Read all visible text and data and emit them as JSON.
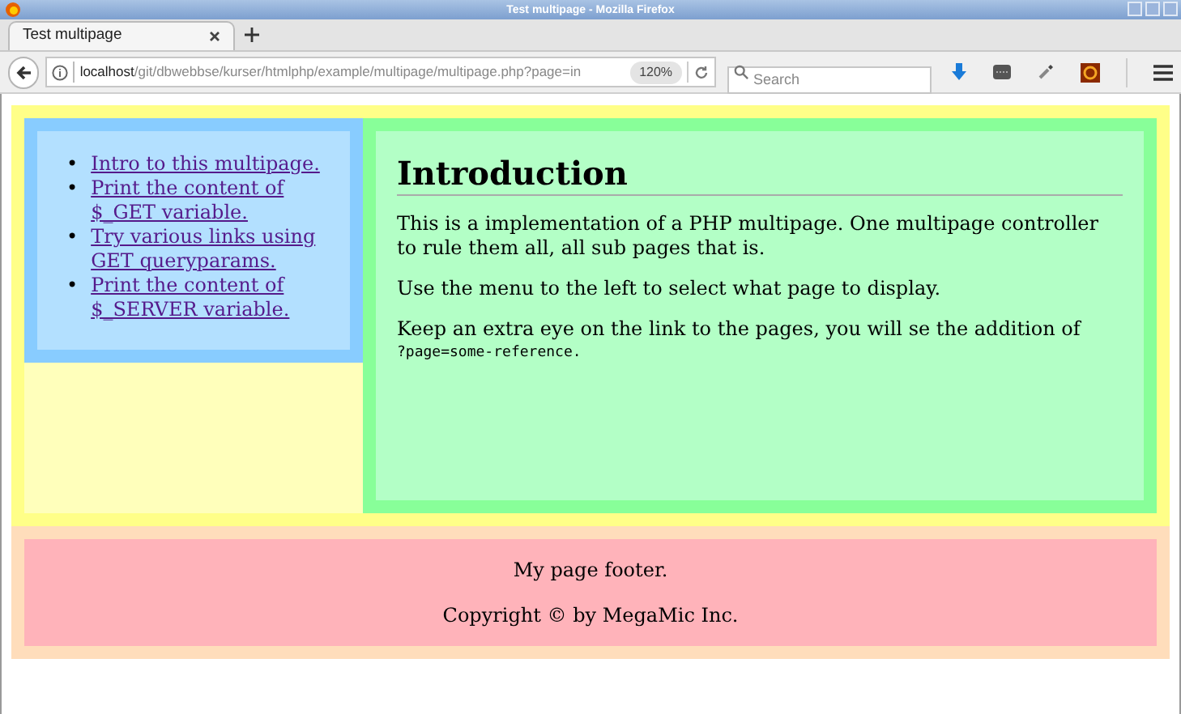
{
  "window": {
    "title": "Test multipage - Mozilla Firefox"
  },
  "tabs": [
    {
      "label": "Test multipage",
      "selected": true
    }
  ],
  "address_bar": {
    "host": "localhost",
    "path": "/git/dbwebbse/kurser/htmlphp/example/multipage/multipage.php?page=in",
    "zoom": "120%"
  },
  "search": {
    "placeholder": "Search"
  },
  "sidebar": {
    "links": [
      {
        "marker": "•",
        "label": "Intro to this multipage."
      },
      {
        "marker": "•",
        "label": "Print the content of $_GET variable."
      },
      {
        "marker": "•",
        "label": "Try various links using GET queryparams."
      },
      {
        "marker": "•",
        "label": "Print the content of $_SERVER variable."
      }
    ]
  },
  "content": {
    "heading": "Introduction",
    "paragraphs": [
      {
        "text": "This is a implementation of a PHP multipage. One multipage controller to rule them all, all sub pages that is."
      },
      {
        "text": "Use the menu to the left to select what page to display."
      },
      {
        "text": "Keep an extra eye on the link to the pages, you will se the addition of",
        "code": "?page=some-reference."
      }
    ]
  },
  "footer": {
    "lines": [
      "My page footer.",
      "Copyright © by MegaMic Inc."
    ]
  }
}
